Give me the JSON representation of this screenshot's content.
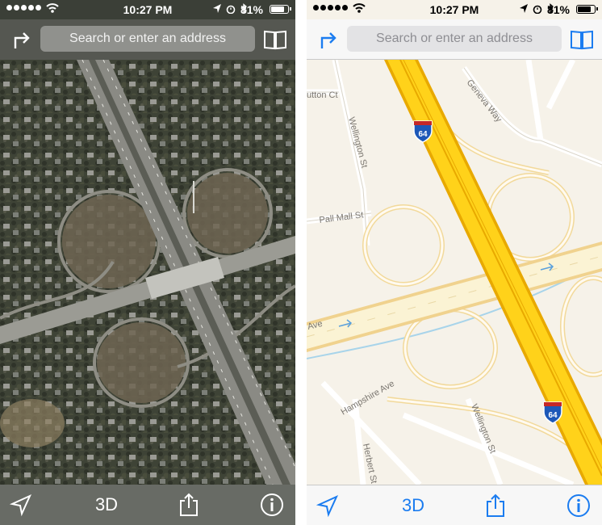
{
  "status_bar": {
    "time": "10:27 PM",
    "battery": "81%"
  },
  "search": {
    "placeholder": "Search or enter an address"
  },
  "toolbar": {
    "threed_label": "3D"
  },
  "map_labels": {
    "interstate_number": "64",
    "streets": {
      "sutton_ct": "utton Ct",
      "wellington_st_top": "Wellington St",
      "geneva_way": "Geneva Way",
      "pall_mall_st": "Pall Mall St",
      "ave_left": "Ave",
      "hampshire_ave": "Hampshire Ave",
      "wellington_st_bottom": "Wellington St",
      "herbert_st": "Herbert St"
    }
  },
  "colors": {
    "accent": "#1b7cf0",
    "interstate": "#ffd21a",
    "interstate_edge": "#e8a900",
    "ramp": "#f2d99a",
    "map_background": "#f6f2e9",
    "water": "#a8d4ea"
  },
  "icons": {
    "directions": "directions-arrow-icon",
    "bookmarks": "book-icon",
    "location": "location-arrow-icon",
    "share": "share-icon",
    "info": "info-icon"
  }
}
